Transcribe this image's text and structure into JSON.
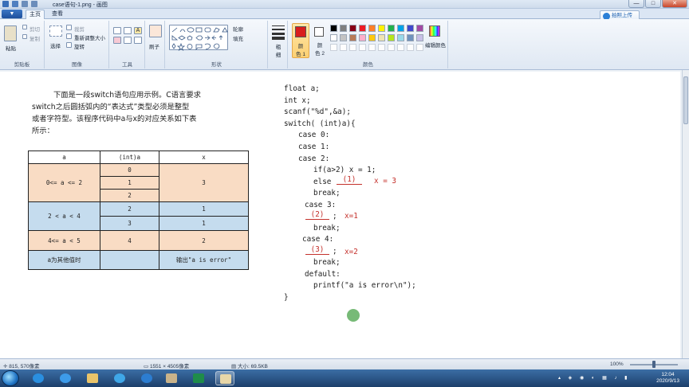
{
  "window": {
    "title": "case语句-1.png - 画图",
    "min": "—",
    "max": "□",
    "close": "✕"
  },
  "ribbon_tabs": {
    "file": "▼",
    "home": "主页",
    "view": "查看"
  },
  "share_button": "拍照上传",
  "clipboard": {
    "paste": "粘贴",
    "cut": "剪切",
    "copy": "复制",
    "group": "剪贴板"
  },
  "image_group": {
    "select": "选择",
    "crop": "裁剪",
    "resize": "重新调整大小",
    "rotate": "旋转",
    "group": "图像"
  },
  "tools_group": {
    "group": "工具"
  },
  "brush": {
    "label": "刷子"
  },
  "shapes": {
    "outline": "轮廓",
    "fill": "填充",
    "group": "形状"
  },
  "size": {
    "label": "粗细"
  },
  "colors": {
    "color1": "颜色 1",
    "color2": "颜色 2",
    "edit": "编辑颜色",
    "group": "颜色",
    "color1_value": "#d81e1e",
    "color2_value": "#ffffff",
    "palette_row1": [
      "#000000",
      "#7f7f7f",
      "#880015",
      "#ed1c24",
      "#ff7f27",
      "#fff200",
      "#22b14c",
      "#00a2e8",
      "#3f48cc",
      "#a349a4"
    ],
    "palette_row2": [
      "#ffffff",
      "#c3c3c3",
      "#b97a57",
      "#ffaec9",
      "#ffc90e",
      "#efe4b0",
      "#b5e61d",
      "#99d9ea",
      "#7092be",
      "#c8bfe7"
    ]
  },
  "content": {
    "intro": [
      "下面是一段switch语句应用示例。C语言要求",
      "switch之后圆括弧内的“表达式”类型必须是整型",
      "或者字符型。该程序代码中a与x的对应关系如下表",
      "所示："
    ],
    "table": {
      "headers": [
        "a",
        "(int)a",
        "x"
      ],
      "rows": [
        {
          "a": "0<= a <= 2",
          "ints": [
            "0",
            "1",
            "2"
          ],
          "x": "3",
          "bg": "#f9dcc4"
        },
        {
          "a": "2 < a < 4",
          "ints": [
            "2",
            "3"
          ],
          "x_rows": [
            "1",
            "1"
          ],
          "bg": "#c5dcee"
        },
        {
          "a": "4<= a < 5",
          "ints": [
            "4"
          ],
          "x": "2",
          "bg": "#f9dcc4"
        },
        {
          "a": "a为其他值时",
          "ints": [
            ""
          ],
          "x": "输出\"a is error\"",
          "bg": "#c5dcee"
        }
      ]
    },
    "code": {
      "l1": "float a;",
      "l2": "int x;",
      "l3": "scanf(\"%d\",&a);",
      "l4": "switch( (int)a){",
      "l5": "case 0:",
      "l6": "case 1:",
      "l7": "case 2:",
      "l8": "if(a>2) x = 1;",
      "l9a": "else",
      "blank1": "(1)",
      "x3": "x = 3",
      "l10": "break;",
      "l11": "case 3:",
      "blank2": "(2)",
      "semi2": ";",
      "x1": "x=1",
      "l12": "break;",
      "l13": "case 4:",
      "blank3": "(3)",
      "semi3": ";",
      "x2": "x=2",
      "l14": "break;",
      "l15": "default:",
      "l16": "printf(\"a is error\\n\");",
      "l17": "}"
    }
  },
  "status": {
    "cursor": "815, 570像素",
    "dims": "1551 × 4505像素",
    "size": "大小: 69.5KB",
    "zoom": "100%"
  },
  "clock": {
    "time": "12:04",
    "date": "2020/9/13"
  }
}
